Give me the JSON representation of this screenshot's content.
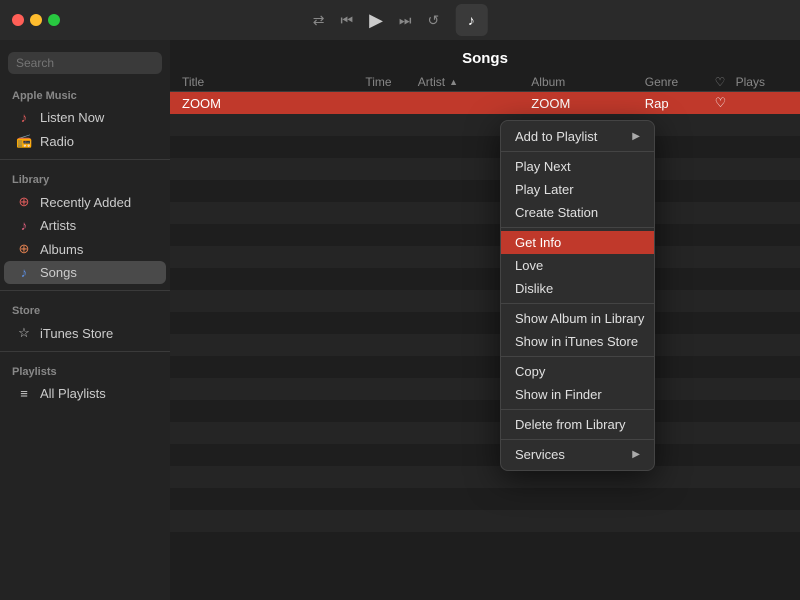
{
  "titleBar": {
    "controls": [
      "⇄",
      "⏮",
      "▶",
      "⏭",
      "↺"
    ],
    "musicIcon": "♪",
    "appleIcon": ""
  },
  "sidebar": {
    "searchPlaceholder": "Search",
    "sections": [
      {
        "label": "Apple Music",
        "items": [
          {
            "id": "listen-now",
            "icon": "♪",
            "iconColor": "red",
            "label": "Listen Now"
          },
          {
            "id": "radio",
            "icon": "📻",
            "iconColor": "pink",
            "label": "Radio"
          }
        ]
      },
      {
        "label": "Library",
        "items": [
          {
            "id": "recently-added",
            "icon": "⊕",
            "iconColor": "red",
            "label": "Recently Added"
          },
          {
            "id": "artists",
            "icon": "♪",
            "iconColor": "pink",
            "label": "Artists"
          },
          {
            "id": "albums",
            "icon": "⊕",
            "iconColor": "orange",
            "label": "Albums"
          },
          {
            "id": "songs",
            "icon": "♪",
            "iconColor": "blue",
            "label": "Songs",
            "active": true
          }
        ]
      },
      {
        "label": "Store",
        "items": [
          {
            "id": "itunes-store",
            "icon": "☆",
            "iconColor": "white",
            "label": "iTunes Store"
          }
        ]
      },
      {
        "label": "Playlists",
        "items": [
          {
            "id": "all-playlists",
            "icon": "≡",
            "iconColor": "white",
            "label": "All Playlists"
          }
        ]
      }
    ]
  },
  "content": {
    "title": "Songs",
    "tableHeaders": [
      "Title",
      "",
      "Time",
      "Artist",
      "Album",
      "Genre",
      "♡",
      "Plays"
    ],
    "highlightedRow": {
      "title": "ZOOM",
      "album": "ZOOM",
      "genre": "Rap",
      "heart": "♡"
    }
  },
  "contextMenu": {
    "items": [
      {
        "id": "add-to-playlist",
        "label": "Add to Playlist",
        "hasArrow": true,
        "dividerAfter": false
      },
      {
        "id": "divider1",
        "divider": true
      },
      {
        "id": "play-next",
        "label": "Play Next",
        "hasArrow": false
      },
      {
        "id": "play-later",
        "label": "Play Later",
        "hasArrow": false
      },
      {
        "id": "create-station",
        "label": "Create Station",
        "hasArrow": false
      },
      {
        "id": "divider2",
        "divider": true
      },
      {
        "id": "get-info",
        "label": "Get Info",
        "hasArrow": false,
        "highlighted": true
      },
      {
        "id": "love",
        "label": "Love",
        "hasArrow": false
      },
      {
        "id": "dislike",
        "label": "Dislike",
        "hasArrow": false
      },
      {
        "id": "divider3",
        "divider": true
      },
      {
        "id": "show-album-in-library",
        "label": "Show Album in Library",
        "hasArrow": false
      },
      {
        "id": "show-in-itunes-store",
        "label": "Show in iTunes Store",
        "hasArrow": false
      },
      {
        "id": "divider4",
        "divider": true
      },
      {
        "id": "copy",
        "label": "Copy",
        "hasArrow": false
      },
      {
        "id": "show-in-finder",
        "label": "Show in Finder",
        "hasArrow": false
      },
      {
        "id": "divider5",
        "divider": true
      },
      {
        "id": "delete-from-library",
        "label": "Delete from Library",
        "hasArrow": false
      },
      {
        "id": "divider6",
        "divider": true
      },
      {
        "id": "services",
        "label": "Services",
        "hasArrow": true
      }
    ]
  }
}
